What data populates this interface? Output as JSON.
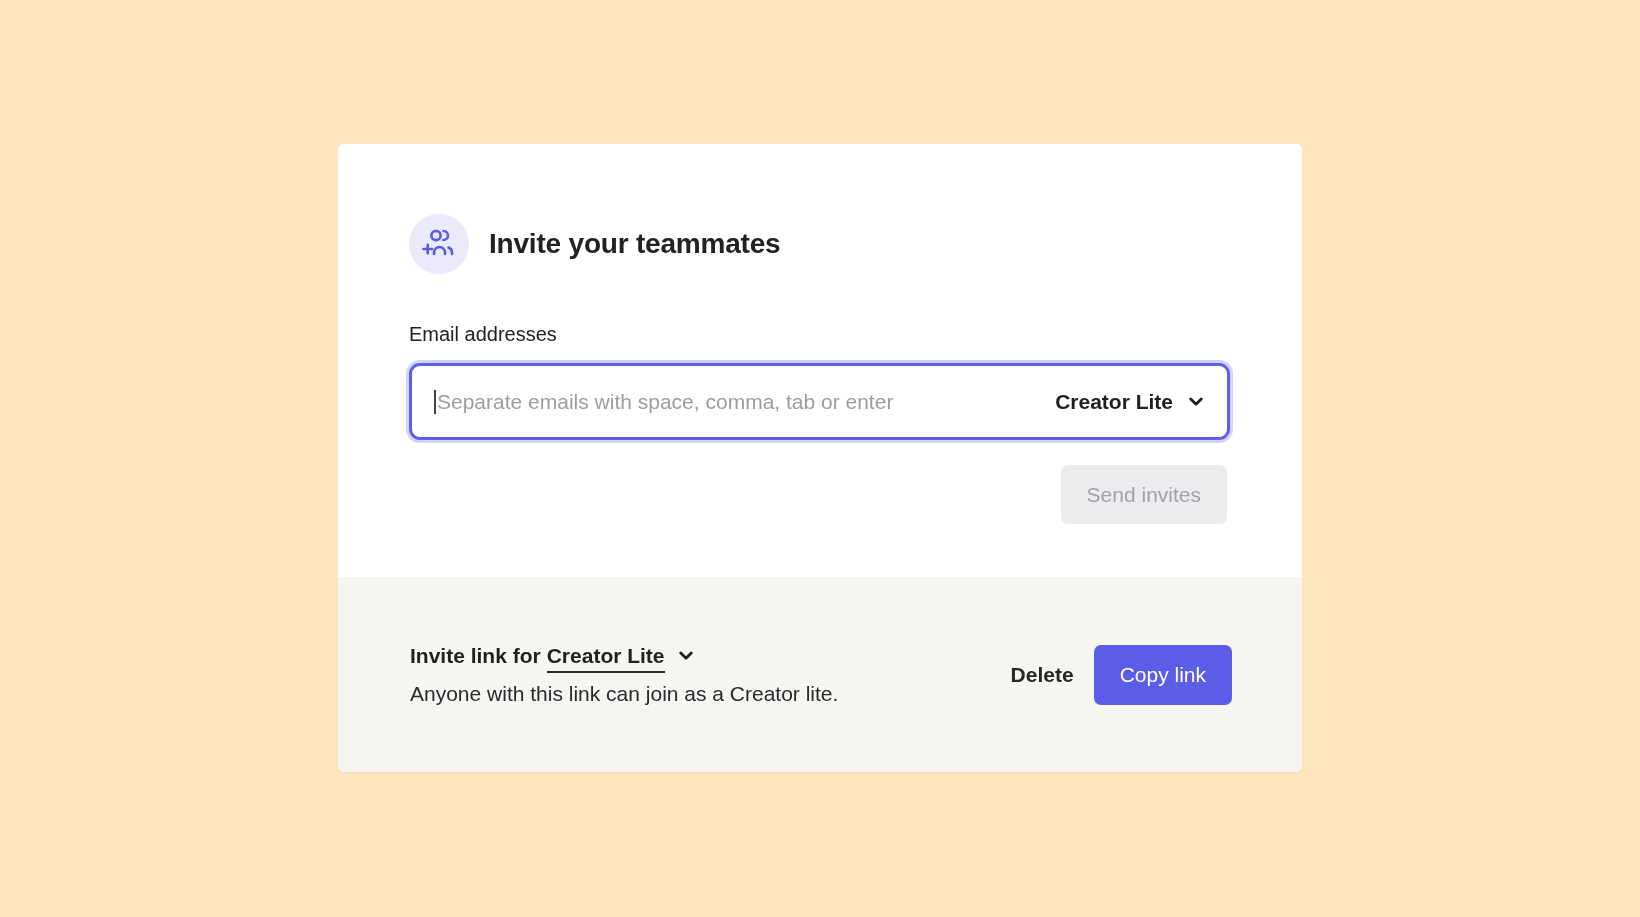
{
  "dialog": {
    "title": "Invite your teammates",
    "email_field": {
      "label": "Email addresses",
      "placeholder": "Separate emails with space, comma, tab or enter",
      "focused": true,
      "role_select": "Creator Lite"
    },
    "send_button": {
      "label": "Send invites",
      "disabled": true
    }
  },
  "invite_link": {
    "prefix": "Invite link for",
    "role": "Creator Lite",
    "description": "Anyone with this link can join as a Creator lite.",
    "actions": [
      {
        "label": "Delete",
        "kind": "text"
      },
      {
        "label": "Copy link",
        "kind": "primary"
      }
    ]
  }
}
